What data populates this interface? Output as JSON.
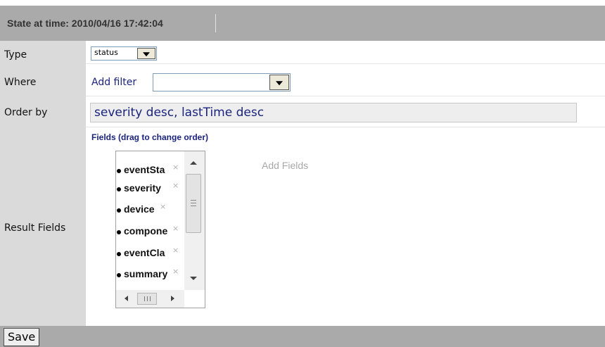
{
  "header": {
    "title": "State at time: 2010/04/16 17:42:04"
  },
  "form": {
    "type": {
      "label": "Type",
      "selected": "status"
    },
    "where": {
      "label": "Where",
      "add_filter_label": "Add filter",
      "filter_selected": ""
    },
    "order_by": {
      "label": "Order by",
      "value": "severity desc, lastTime desc"
    },
    "result_fields": {
      "label": "Result Fields",
      "header": "Fields (drag to change order)",
      "items": [
        {
          "name": "eventSta"
        },
        {
          "name": "severity"
        },
        {
          "name": "device"
        },
        {
          "name": "compone"
        },
        {
          "name": "eventCla"
        },
        {
          "name": "summary"
        }
      ],
      "remove_glyph": "×",
      "add_fields_label": "Add Fields"
    }
  },
  "footer": {
    "save_label": "Save"
  },
  "icons": {
    "dropdown": "chevron-down-icon",
    "remove": "close-icon",
    "scroll_up": "arrow-up-icon",
    "scroll_down": "arrow-down-icon",
    "scroll_left": "arrow-left-icon",
    "scroll_right": "arrow-right-icon"
  },
  "colors": {
    "header_bg": "#aaaaaa",
    "label_col_bg": "#dadada",
    "link_text": "#1a237e",
    "muted_text": "#a8a8a8"
  }
}
